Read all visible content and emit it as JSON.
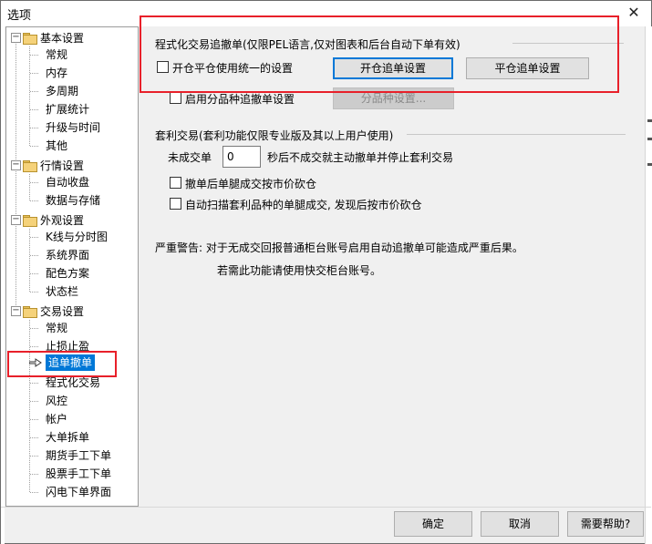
{
  "window": {
    "title": "选项",
    "close_label": "✕"
  },
  "tree": {
    "groups": [
      {
        "label": "基本设置",
        "expander": "−",
        "items": [
          "常规",
          "内存",
          "多周期",
          "扩展统计",
          "升级与时间",
          "其他"
        ]
      },
      {
        "label": "行情设置",
        "expander": "−",
        "items": [
          "自动收盘",
          "数据与存储"
        ]
      },
      {
        "label": "外观设置",
        "expander": "−",
        "items": [
          "K线与分时图",
          "系统界面",
          "配色方案",
          "状态栏"
        ]
      },
      {
        "label": "交易设置",
        "expander": "−",
        "items": [
          "常规",
          "止损止盈",
          "追单撤单",
          "程式化交易",
          "风控",
          "帐户",
          "大单拆单",
          "期货手工下单",
          "股票手工下单",
          "闪电下单界面"
        ]
      }
    ],
    "selected": "追单撤单"
  },
  "prog_section": {
    "title": "程式化交易追撤单(仅限PEL语言,仅对图表和后台自动下单有效)",
    "unify_checkbox_label": "开仓平仓使用统一的设置",
    "open_button": "开仓追单设置",
    "close_button": "平仓追单设置",
    "variety_checkbox_label": "启用分品种追撤单设置",
    "variety_button": "分品种设置..."
  },
  "arb_section": {
    "title": "套利交易(套利功能仅限专业版及其以上用户使用)",
    "untraded_label": "未成交单",
    "untraded_value": "0",
    "untraded_suffix": "秒后不成交就主动撤单并停止套利交易",
    "cb1_label": "撤单后单腿成交按市价砍仓",
    "cb2_label": "自动扫描套利品种的单腿成交, 发现后按市价砍仓"
  },
  "warning": {
    "line1": "严重警告: 对于无成交回报普通柜台账号启用自动追撤单可能造成严重后果。",
    "line2": "若需此功能请使用快交柜台账号。"
  },
  "footer": {
    "ok": "确定",
    "cancel": "取消",
    "help": "需要帮助?"
  },
  "colors": {
    "highlight": "#e8202a",
    "selection": "#0078d7"
  }
}
